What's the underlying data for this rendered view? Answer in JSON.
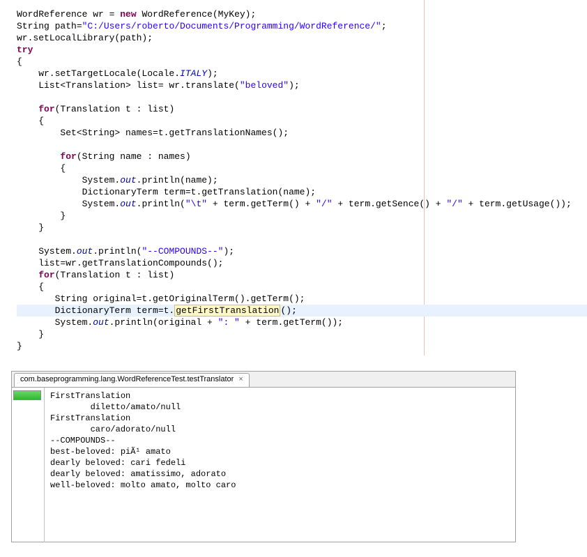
{
  "code": {
    "kw_new": "new",
    "kw_try": "try",
    "kw_for1": "for",
    "kw_for2": "for",
    "kw_for3": "for",
    "l1a": "WordReference wr = ",
    "l1b": " WordReference(MyKey);",
    "l2a": "String path=",
    "l2b": "\"C:/Users/roberto/Documents/Programming/WordReference/\"",
    "l2c": ";",
    "l3": "wr.setLocalLibrary(path);",
    "l5": "{",
    "l6a": "    wr.setTargetLocale(Locale.",
    "l6b": "ITALY",
    "l6c": ");",
    "l7a": "    List<Translation> list= wr.translate(",
    "l7b": "\"beloved\"",
    "l7c": ");",
    "l9a": "(Translation t : list)",
    "l10": "    {",
    "l11": "        Set<String> names=t.getTranslationNames();",
    "l13a": "(String name : names)",
    "l14": "        {",
    "l15a": "            System.",
    "l15b": "out",
    "l15c": ".println(name);",
    "l16": "            DictionaryTerm term=t.getTranslation(name);",
    "l17a": "            System.",
    "l17b": "out",
    "l17c": ".println(",
    "l17d": "\"\\t\"",
    "l17e": " + term.getTerm() + ",
    "l17f": "\"/\"",
    "l17g": " + term.getSence() + ",
    "l17h": "\"/\"",
    "l17i": " + term.getUsage());",
    "l18": "        }",
    "l19": "    }",
    "l21a": "    System.",
    "l21b": "out",
    "l21c": ".println(",
    "l21d": "\"--COMPOUNDS--\"",
    "l21e": ");",
    "l22": "    list=wr.getTranslationCompounds();",
    "l23a": "(Translation t : list)",
    "l24": "    {",
    "l25": "       String original=t.getOriginalTerm().getTerm();",
    "l26a": "       DictionaryTerm term=t.",
    "l26b": "getFirstTranslation",
    "l26c": "();",
    "l27a": "       System.",
    "l27b": "out",
    "l27c": ".println(original + ",
    "l27d": "\": \"",
    "l27e": " + term.getTerm());",
    "l28": "    }",
    "l29": "}"
  },
  "console": {
    "tab_label": "com.baseprogramming.lang.WordReferenceTest.testTranslator",
    "lines": [
      "FirstTranslation",
      "        diletto/amato/null",
      "FirstTranslation",
      "        caro/adorato/null",
      "--COMPOUNDS--",
      "best-beloved: piÃ¹ amato",
      "dearly beloved: cari fedeli",
      "dearly beloved: amatissimo, adorato",
      "well-beloved: molto amato, molto caro"
    ]
  }
}
